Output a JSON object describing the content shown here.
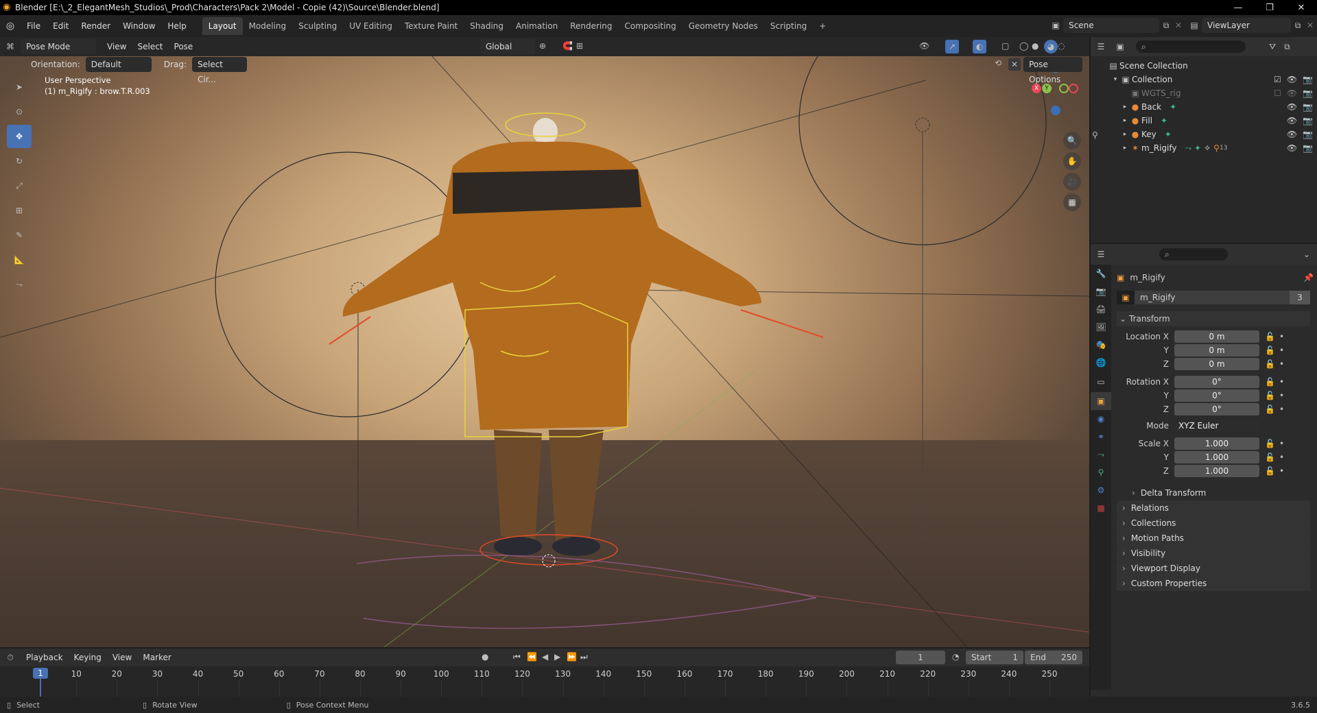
{
  "window": {
    "title": "Blender [E:\\_2_ElegantMesh_Studios\\_Prod\\Characters\\Pack 2\\Model - Copie (42)\\Source\\Blender.blend]"
  },
  "menubar": {
    "items": [
      "File",
      "Edit",
      "Render",
      "Window",
      "Help"
    ],
    "workspaces": [
      "Layout",
      "Modeling",
      "Sculpting",
      "UV Editing",
      "Texture Paint",
      "Shading",
      "Animation",
      "Rendering",
      "Compositing",
      "Geometry Nodes",
      "Scripting"
    ],
    "active_workspace": "Layout",
    "add_tab": "+",
    "scene": "Scene",
    "view_layer": "ViewLayer"
  },
  "viewport_header": {
    "mode": "Pose Mode",
    "menus": [
      "View",
      "Select",
      "Pose"
    ],
    "transform_orientation": "Global",
    "orientation_label": "Orientation:",
    "orientation_value": "Default",
    "drag_label": "Drag:",
    "drag_value": "Select Cir...",
    "pose_options": "Pose Options"
  },
  "viewport": {
    "perspective": "User Perspective",
    "active_object": "(1) m_Rigify : brow.T.R.003",
    "gizmo_axes": [
      "X",
      "Y",
      "Z"
    ]
  },
  "outliner": {
    "root": "Scene Collection",
    "collection": "Collection",
    "items": [
      {
        "name": "WGTS_rig",
        "dim": true
      },
      {
        "name": "Back"
      },
      {
        "name": "Fill"
      },
      {
        "name": "Key"
      },
      {
        "name": "m_Rigify"
      }
    ],
    "rigify_badge": "13"
  },
  "properties": {
    "object_name": "m_Rigify",
    "data_name": "m_Rigify",
    "data_users": "3",
    "transform_title": "Transform",
    "location": {
      "label": "Location X",
      "x": "0 m",
      "y": "0 m",
      "z": "0 m"
    },
    "rotation": {
      "label": "Rotation X",
      "x": "0°",
      "y": "0°",
      "z": "0°"
    },
    "mode_label": "Mode",
    "mode_value": "XYZ Euler",
    "scale": {
      "label": "Scale X",
      "x": "1.000",
      "y": "1.000",
      "z": "1.000"
    },
    "axis_y": "Y",
    "axis_z": "Z",
    "panels": [
      "Delta Transform",
      "Relations",
      "Collections",
      "Motion Paths",
      "Visibility",
      "Viewport Display",
      "Custom Properties"
    ]
  },
  "timeline": {
    "menus": [
      "Playback",
      "Keying",
      "View",
      "Marker"
    ],
    "current_frame": "1",
    "start_label": "Start",
    "start": "1",
    "end_label": "End",
    "end": "250",
    "ruler": [
      "1",
      "10",
      "20",
      "30",
      "40",
      "50",
      "60",
      "70",
      "80",
      "90",
      "100",
      "110",
      "120",
      "130",
      "140",
      "150",
      "160",
      "170",
      "180",
      "190",
      "200",
      "210",
      "220",
      "230",
      "240",
      "250"
    ]
  },
  "statusbar": {
    "select": "Select",
    "rotate": "Rotate View",
    "context": "Pose Context Menu",
    "version": "3.6.5"
  },
  "colors": {
    "accent": "#4772b3",
    "axis_x": "#e8455a",
    "axis_y": "#8bc34a",
    "axis_z": "#3d83d9",
    "bone_yellow": "#e9d23a",
    "bone_red": "#e24a2a"
  }
}
